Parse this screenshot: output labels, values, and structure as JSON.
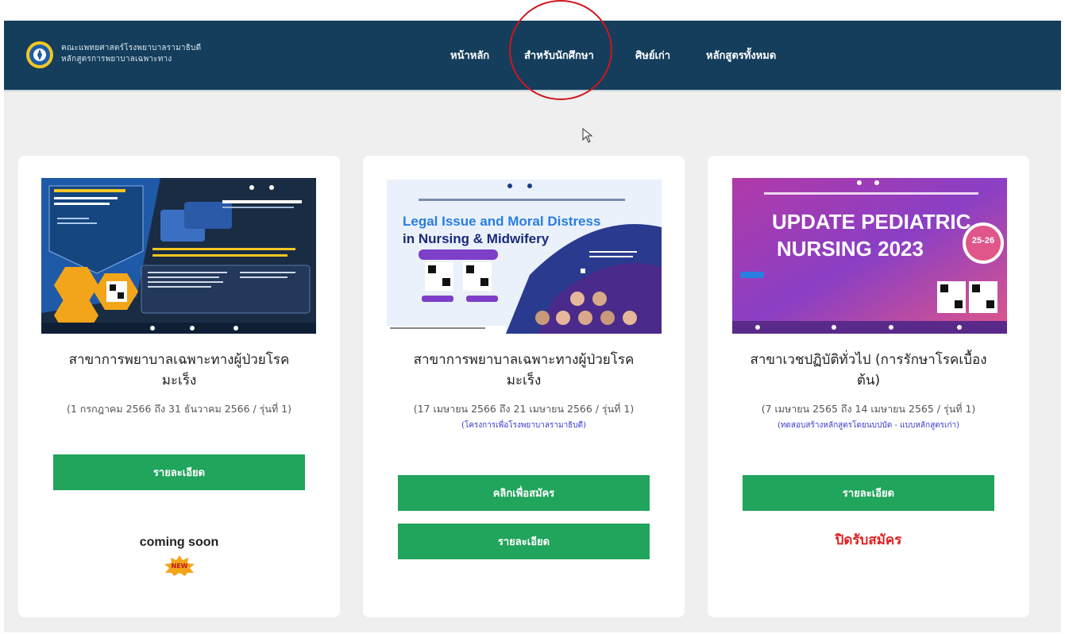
{
  "navbar": {
    "brand_line1": "คณะแพทยศาสตร์โรงพยาบาลรามาธิบดี",
    "brand_line2": "หลักสูตรการพยาบาลเฉพาะทาง",
    "links": [
      "หน้าหลัก",
      "สำหรับนักศึกษา",
      "ศิษย์เก่า",
      "หลักสูตรทั้งหมด"
    ]
  },
  "cards": [
    {
      "title_line1": "สาขาการพยาบาลเฉพาะทางผู้ป่วยโรค",
      "title_line2": "มะเร็ง",
      "date": "(1 กรกฎาคม 2566 ถึง 31 ธันวาคม 2566 / รุ่นที่ 1)",
      "detail_button": "รายละเอียด",
      "coming_soon": "coming soon",
      "badge": "NEW"
    },
    {
      "banner_title1": "Legal Issue and Moral Distress",
      "banner_title2": "in Nursing & Midwifery",
      "title_line1": "สาขาการพยาบาลเฉพาะทางผู้ป่วยโรค",
      "title_line2": "มะเร็ง",
      "date": "(17 เมษายน 2566 ถึง 21 เมษายน 2566 / รุ่นที่ 1)",
      "note": "(โครงการเพื่อโรงพยาบาลรามาธิบดี)",
      "apply_button": "คลิกเพื่อสมัคร",
      "detail_button": "รายละเอียด"
    },
    {
      "banner_title1": "UPDATE PEDIATRIC",
      "banner_title2": "NURSING 2023",
      "banner_dates": "25-26",
      "title_line1": "สาขาเวชปฏิบัติทั่วไป (การรักษาโรคเบื้อง",
      "title_line2": "ต้น)",
      "date": "(7 เมษายน 2565 ถึง 14 เมษายน 2565 / รุ่นที่ 1)",
      "note": "(ทดสอบสร้างหลักสูตรโดยนบปบัต - แบบหลักสูตรเก่า)",
      "detail_button": "รายละเอียด",
      "closed": "ปิดรับสมัคร"
    }
  ],
  "colors": {
    "navbar": "#143e5c",
    "button": "#21a45c",
    "closed": "#e02020",
    "highlight": "#d0161c"
  }
}
